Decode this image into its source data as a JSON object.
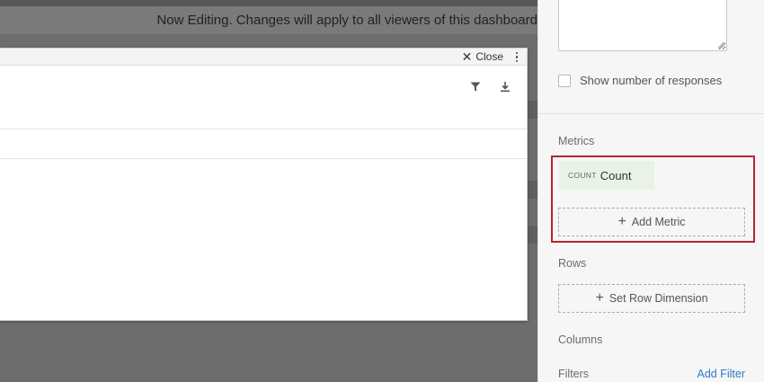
{
  "banner": {
    "text": "Now Editing. Changes will apply to all viewers of this dashboard"
  },
  "modal": {
    "close_label": "Close",
    "icons": {
      "close": "close-icon",
      "menu": "more-vertical-icon",
      "filter": "filter-icon",
      "download": "download-icon"
    }
  },
  "panel": {
    "show_responses_label": "Show number of responses",
    "show_responses_checked": false,
    "metrics_label": "Metrics",
    "metric_chip": {
      "aggregation": "COUNT",
      "name": "Count"
    },
    "add_metric_label": "Add Metric",
    "rows_label": "Rows",
    "set_row_label": "Set Row Dimension",
    "columns_label": "Columns",
    "filters_label": "Filters",
    "add_filter_label": "Add Filter"
  },
  "colors": {
    "highlight": "#b5262f",
    "chip_bg": "#e8f2e6",
    "link": "#2f7bc1",
    "overlay": "#6d6d6d"
  }
}
